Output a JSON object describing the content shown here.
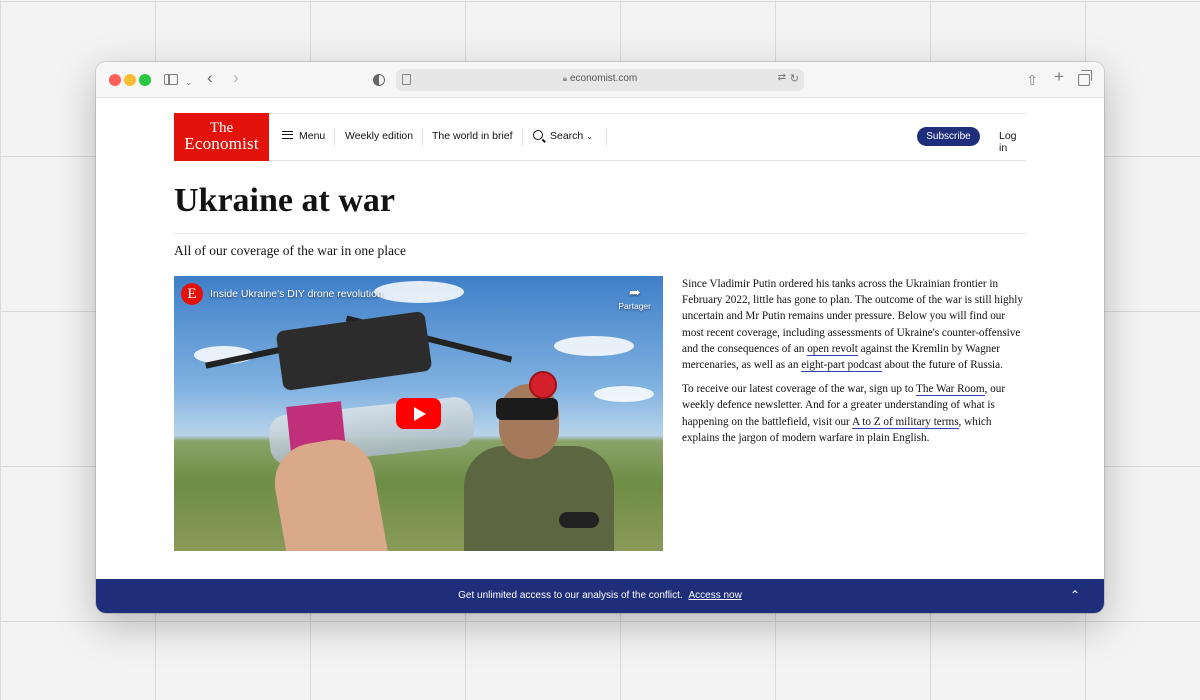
{
  "browser": {
    "url": "economist.com"
  },
  "header": {
    "logo_line1": "The",
    "logo_line2": "Economist",
    "menu_label": "Menu",
    "weekly_label": "Weekly edition",
    "world_label": "The world in brief",
    "search_label": "Search",
    "subscribe_label": "Subscribe",
    "login_label": "Log in"
  },
  "page": {
    "title": "Ukraine at war",
    "subtitle": "All of our coverage of the war in one place"
  },
  "video": {
    "logo_letter": "E",
    "title": "Inside Ukraine's DIY drone revolution",
    "share_label": "Partager"
  },
  "article": {
    "p1_a": "Since Vladimir Putin ordered his tanks across the Ukrainian frontier in February 2022, little has gone to plan. The outcome of the war is still highly uncertain and Mr Putin remains under pressure. Below you will find our most recent coverage, including assessments of Ukraine's counter-offensive and the consequences of an ",
    "p1_link1": "open revolt",
    "p1_b": " against the Kremlin by Wagner mercenaries, as well as an ",
    "p1_link2": "eight-part podcast",
    "p1_c": " about the future of Russia.",
    "p2_a": "To receive our latest coverage of the war, sign up to ",
    "p2_link1": "The War Room",
    "p2_b": ", our weekly defence newsletter. And for a greater understanding of what is happening on the battlefield, visit our ",
    "p2_link2": "A to Z of military terms",
    "p2_c": ", which explains the jargon of modern warfare in plain English."
  },
  "promo": {
    "text": "Get unlimited access to our analysis of the conflict.",
    "link": "Access now"
  },
  "colors": {
    "brand_red": "#e3120b",
    "navy": "#1f2e7a",
    "link_underline": "#2e45b8"
  }
}
